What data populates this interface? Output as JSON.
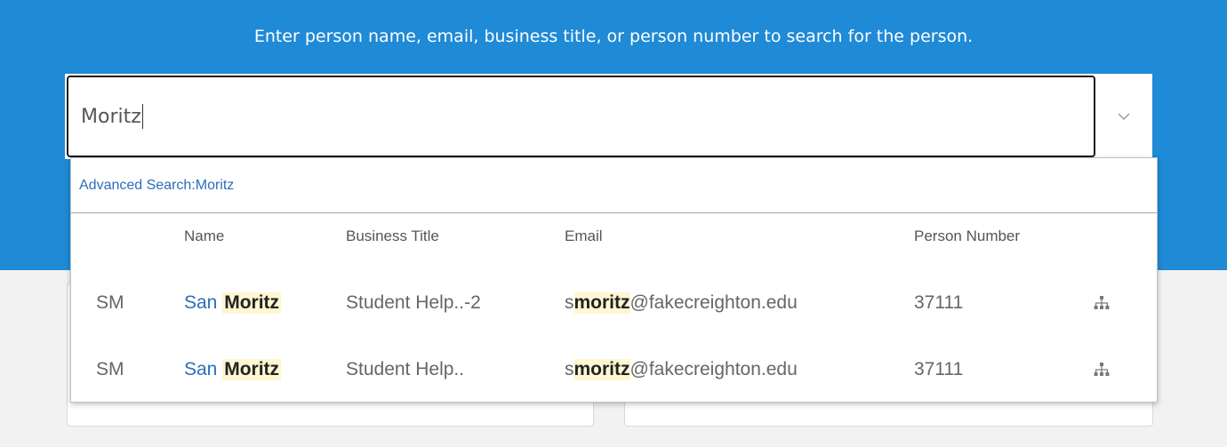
{
  "prompt": "Enter person name, email, business title, or person number to search for the person.",
  "search": {
    "value": "Moritz"
  },
  "results_panel": {
    "advanced_search_label": "Advanced Search:Moritz",
    "headers": {
      "name": "Name",
      "title": "Business Title",
      "email": "Email",
      "number": "Person Number"
    },
    "rows": [
      {
        "initials": "SM",
        "first": "San",
        "last": "Moritz",
        "title": "Student Help..-2",
        "email_pre": "s",
        "email_match": "moritz",
        "email_post": "@fakecreighton.edu",
        "number": "37111"
      },
      {
        "initials": "SM",
        "first": "San",
        "last": "Moritz",
        "title": "Student Help..",
        "email_pre": "s",
        "email_match": "moritz",
        "email_post": "@fakecreighton.edu",
        "number": "37111"
      }
    ]
  },
  "icons": {
    "dropdown": "chevron-down-icon",
    "org_chart": "org-chart-icon"
  },
  "colors": {
    "banner": "#1f8ad6",
    "link": "#2a6ebb",
    "highlight": "#fdf7d2"
  }
}
